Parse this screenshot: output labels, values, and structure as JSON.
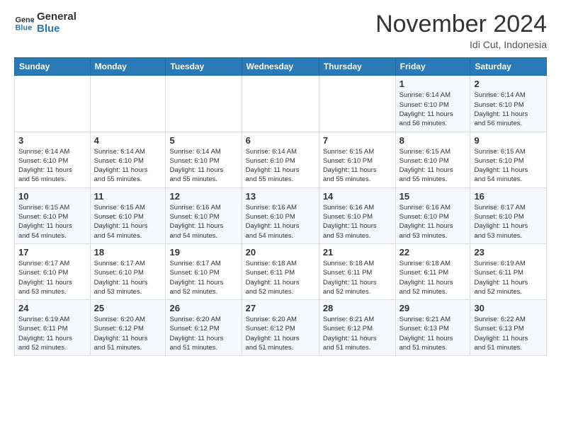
{
  "header": {
    "logo_line1": "General",
    "logo_line2": "Blue",
    "month_title": "November 2024",
    "location": "Idi Cut, Indonesia"
  },
  "days_of_week": [
    "Sunday",
    "Monday",
    "Tuesday",
    "Wednesday",
    "Thursday",
    "Friday",
    "Saturday"
  ],
  "weeks": [
    [
      {
        "day": "",
        "info": ""
      },
      {
        "day": "",
        "info": ""
      },
      {
        "day": "",
        "info": ""
      },
      {
        "day": "",
        "info": ""
      },
      {
        "day": "",
        "info": ""
      },
      {
        "day": "1",
        "info": "Sunrise: 6:14 AM\nSunset: 6:10 PM\nDaylight: 11 hours\nand 56 minutes."
      },
      {
        "day": "2",
        "info": "Sunrise: 6:14 AM\nSunset: 6:10 PM\nDaylight: 11 hours\nand 56 minutes."
      }
    ],
    [
      {
        "day": "3",
        "info": "Sunrise: 6:14 AM\nSunset: 6:10 PM\nDaylight: 11 hours\nand 56 minutes."
      },
      {
        "day": "4",
        "info": "Sunrise: 6:14 AM\nSunset: 6:10 PM\nDaylight: 11 hours\nand 55 minutes."
      },
      {
        "day": "5",
        "info": "Sunrise: 6:14 AM\nSunset: 6:10 PM\nDaylight: 11 hours\nand 55 minutes."
      },
      {
        "day": "6",
        "info": "Sunrise: 6:14 AM\nSunset: 6:10 PM\nDaylight: 11 hours\nand 55 minutes."
      },
      {
        "day": "7",
        "info": "Sunrise: 6:15 AM\nSunset: 6:10 PM\nDaylight: 11 hours\nand 55 minutes."
      },
      {
        "day": "8",
        "info": "Sunrise: 6:15 AM\nSunset: 6:10 PM\nDaylight: 11 hours\nand 55 minutes."
      },
      {
        "day": "9",
        "info": "Sunrise: 6:15 AM\nSunset: 6:10 PM\nDaylight: 11 hours\nand 54 minutes."
      }
    ],
    [
      {
        "day": "10",
        "info": "Sunrise: 6:15 AM\nSunset: 6:10 PM\nDaylight: 11 hours\nand 54 minutes."
      },
      {
        "day": "11",
        "info": "Sunrise: 6:15 AM\nSunset: 6:10 PM\nDaylight: 11 hours\nand 54 minutes."
      },
      {
        "day": "12",
        "info": "Sunrise: 6:16 AM\nSunset: 6:10 PM\nDaylight: 11 hours\nand 54 minutes."
      },
      {
        "day": "13",
        "info": "Sunrise: 6:16 AM\nSunset: 6:10 PM\nDaylight: 11 hours\nand 54 minutes."
      },
      {
        "day": "14",
        "info": "Sunrise: 6:16 AM\nSunset: 6:10 PM\nDaylight: 11 hours\nand 53 minutes."
      },
      {
        "day": "15",
        "info": "Sunrise: 6:16 AM\nSunset: 6:10 PM\nDaylight: 11 hours\nand 53 minutes."
      },
      {
        "day": "16",
        "info": "Sunrise: 6:17 AM\nSunset: 6:10 PM\nDaylight: 11 hours\nand 53 minutes."
      }
    ],
    [
      {
        "day": "17",
        "info": "Sunrise: 6:17 AM\nSunset: 6:10 PM\nDaylight: 11 hours\nand 53 minutes."
      },
      {
        "day": "18",
        "info": "Sunrise: 6:17 AM\nSunset: 6:10 PM\nDaylight: 11 hours\nand 53 minutes."
      },
      {
        "day": "19",
        "info": "Sunrise: 6:17 AM\nSunset: 6:10 PM\nDaylight: 11 hours\nand 52 minutes."
      },
      {
        "day": "20",
        "info": "Sunrise: 6:18 AM\nSunset: 6:11 PM\nDaylight: 11 hours\nand 52 minutes."
      },
      {
        "day": "21",
        "info": "Sunrise: 6:18 AM\nSunset: 6:11 PM\nDaylight: 11 hours\nand 52 minutes."
      },
      {
        "day": "22",
        "info": "Sunrise: 6:18 AM\nSunset: 6:11 PM\nDaylight: 11 hours\nand 52 minutes."
      },
      {
        "day": "23",
        "info": "Sunrise: 6:19 AM\nSunset: 6:11 PM\nDaylight: 11 hours\nand 52 minutes."
      }
    ],
    [
      {
        "day": "24",
        "info": "Sunrise: 6:19 AM\nSunset: 6:11 PM\nDaylight: 11 hours\nand 52 minutes."
      },
      {
        "day": "25",
        "info": "Sunrise: 6:20 AM\nSunset: 6:12 PM\nDaylight: 11 hours\nand 51 minutes."
      },
      {
        "day": "26",
        "info": "Sunrise: 6:20 AM\nSunset: 6:12 PM\nDaylight: 11 hours\nand 51 minutes."
      },
      {
        "day": "27",
        "info": "Sunrise: 6:20 AM\nSunset: 6:12 PM\nDaylight: 11 hours\nand 51 minutes."
      },
      {
        "day": "28",
        "info": "Sunrise: 6:21 AM\nSunset: 6:12 PM\nDaylight: 11 hours\nand 51 minutes."
      },
      {
        "day": "29",
        "info": "Sunrise: 6:21 AM\nSunset: 6:13 PM\nDaylight: 11 hours\nand 51 minutes."
      },
      {
        "day": "30",
        "info": "Sunrise: 6:22 AM\nSunset: 6:13 PM\nDaylight: 11 hours\nand 51 minutes."
      }
    ]
  ]
}
